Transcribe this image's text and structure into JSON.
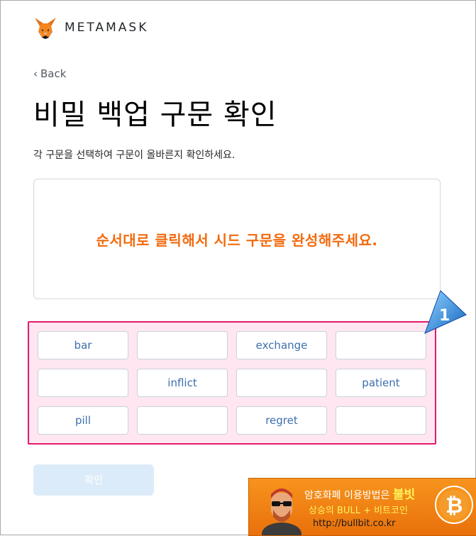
{
  "brand": {
    "name": "METAMASK"
  },
  "nav": {
    "back_label": "Back"
  },
  "page": {
    "title": "비밀 백업 구문 확인",
    "instruction": "각 구문을 선택하여 구문이 올바른지 확인하세요.",
    "drop_hint": "순서대로 클릭해서 시드 구문을 완성해주세요."
  },
  "words": [
    "bar",
    "",
    "exchange",
    "",
    "",
    "inflict",
    "",
    "patient",
    "pill",
    "",
    "regret",
    ""
  ],
  "callout": {
    "number": "1"
  },
  "confirm_label": "확인",
  "ad": {
    "line1_prefix": "암호화폐 이용방법은",
    "brand": "불빗",
    "line2": "상승의 BULL + 비트코인",
    "url": "http://bullbit.co.kr"
  },
  "colors": {
    "hint_orange": "#f26a0e",
    "highlight_border": "#e21b6e",
    "word_text": "#3d6fae",
    "button_disabled": "#dcebf9"
  }
}
